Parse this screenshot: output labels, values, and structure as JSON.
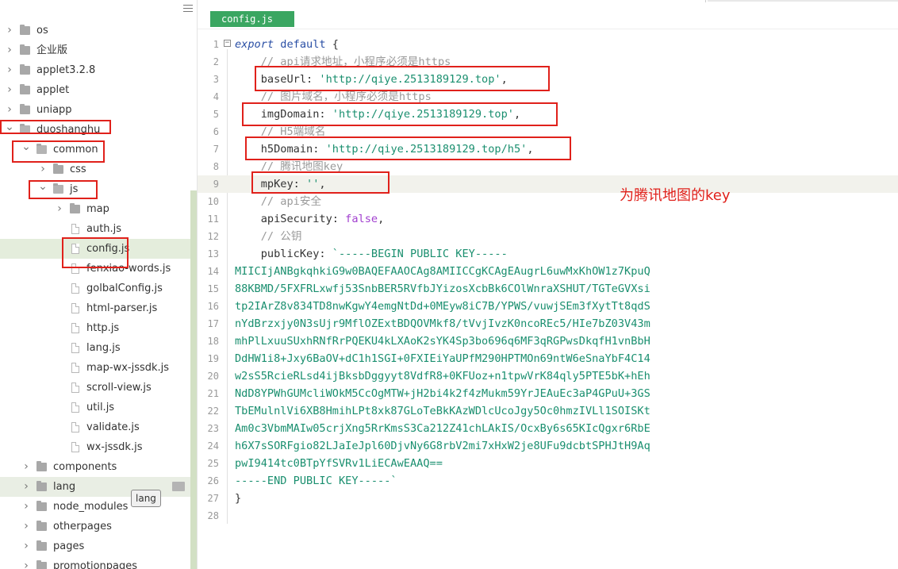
{
  "sidebar": {
    "tooltip": "lang",
    "items": [
      {
        "label": "os",
        "type": "folder",
        "level": 0,
        "state": "collapsed"
      },
      {
        "label": "企业版",
        "type": "folder",
        "level": 0,
        "state": "collapsed"
      },
      {
        "label": "applet3.2.8",
        "type": "folder",
        "level": 0,
        "state": "collapsed"
      },
      {
        "label": "applet",
        "type": "folder",
        "level": 0,
        "state": "collapsed"
      },
      {
        "label": "uniapp",
        "type": "folder",
        "level": 0,
        "state": "collapsed"
      },
      {
        "label": "duoshanghu",
        "type": "folder",
        "level": 0,
        "state": "expanded"
      },
      {
        "label": "common",
        "type": "folder",
        "level": 1,
        "state": "expanded"
      },
      {
        "label": "css",
        "type": "folder",
        "level": 2,
        "state": "collapsed"
      },
      {
        "label": "js",
        "type": "folder",
        "level": 2,
        "state": "expanded"
      },
      {
        "label": "map",
        "type": "folder",
        "level": 3,
        "state": "collapsed"
      },
      {
        "label": "auth.js",
        "type": "file",
        "level": 3
      },
      {
        "label": "config.js",
        "type": "file",
        "level": 3,
        "selected": true
      },
      {
        "label": "fenxiao-words.js",
        "type": "file",
        "level": 3
      },
      {
        "label": "golbalConfig.js",
        "type": "file",
        "level": 3
      },
      {
        "label": "html-parser.js",
        "type": "file",
        "level": 3
      },
      {
        "label": "http.js",
        "type": "file",
        "level": 3
      },
      {
        "label": "lang.js",
        "type": "file",
        "level": 3
      },
      {
        "label": "map-wx-jssdk.js",
        "type": "file",
        "level": 3
      },
      {
        "label": "scroll-view.js",
        "type": "file",
        "level": 3
      },
      {
        "label": "util.js",
        "type": "file",
        "level": 3
      },
      {
        "label": "validate.js",
        "type": "file",
        "level": 3
      },
      {
        "label": "wx-jssdk.js",
        "type": "file",
        "level": 3
      },
      {
        "label": "components",
        "type": "folder",
        "level": 1,
        "state": "collapsed"
      },
      {
        "label": "lang",
        "type": "folder",
        "level": 1,
        "state": "collapsed",
        "hover": true
      },
      {
        "label": "node_modules",
        "type": "folder",
        "level": 1,
        "state": "collapsed"
      },
      {
        "label": "otherpages",
        "type": "folder",
        "level": 1,
        "state": "collapsed"
      },
      {
        "label": "pages",
        "type": "folder",
        "level": 1,
        "state": "collapsed"
      },
      {
        "label": "promotionpages",
        "type": "folder",
        "level": 1,
        "state": "collapsed"
      }
    ]
  },
  "editor": {
    "tab": "config.js",
    "current_line": 9,
    "annotation": "为腾讯地图的key",
    "lines": [
      [
        [
          "kw",
          "export"
        ],
        [
          "t",
          " "
        ],
        [
          "kw2",
          "default"
        ],
        [
          "t",
          " {"
        ]
      ],
      [
        [
          "t",
          "    "
        ],
        [
          "cm",
          "// api请求地址，小程序必须是https"
        ]
      ],
      [
        [
          "t",
          "    "
        ],
        [
          "key",
          "baseUrl"
        ],
        [
          "t",
          ": "
        ],
        [
          "str",
          "'http://qiye.2513189129.top'"
        ],
        [
          "t",
          ","
        ]
      ],
      [
        [
          "t",
          "    "
        ],
        [
          "cm",
          "// 图片域名，小程序必须是https"
        ]
      ],
      [
        [
          "t",
          "    "
        ],
        [
          "key",
          "imgDomain"
        ],
        [
          "t",
          ": "
        ],
        [
          "str",
          "'http://qiye.2513189129.top'"
        ],
        [
          "t",
          ","
        ]
      ],
      [
        [
          "t",
          "    "
        ],
        [
          "cm",
          "// H5端域名"
        ]
      ],
      [
        [
          "t",
          "    "
        ],
        [
          "key",
          "h5Domain"
        ],
        [
          "t",
          ": "
        ],
        [
          "str",
          "'http://qiye.2513189129.top/h5'"
        ],
        [
          "t",
          ","
        ]
      ],
      [
        [
          "t",
          "    "
        ],
        [
          "cm",
          "// 腾讯地图key"
        ]
      ],
      [
        [
          "t",
          "    "
        ],
        [
          "key",
          "mpKey"
        ],
        [
          "t",
          ": "
        ],
        [
          "str",
          "''"
        ],
        [
          "t",
          ","
        ]
      ],
      [
        [
          "t",
          "    "
        ],
        [
          "cm",
          "// api安全"
        ]
      ],
      [
        [
          "t",
          "    "
        ],
        [
          "key",
          "apiSecurity"
        ],
        [
          "t",
          ": "
        ],
        [
          "bool",
          "false"
        ],
        [
          "t",
          ","
        ]
      ],
      [
        [
          "t",
          "    "
        ],
        [
          "cm",
          "// 公钥"
        ]
      ],
      [
        [
          "t",
          "    "
        ],
        [
          "key",
          "publicKey"
        ],
        [
          "t",
          ": "
        ],
        [
          "str",
          "`-----BEGIN PUBLIC KEY-----"
        ]
      ],
      [
        [
          "str",
          "MIICIjANBgkqhkiG9w0BAQEFAAOCAg8AMIICCgKCAgEAugrL6uwMxKhOW1z7KpuQ"
        ]
      ],
      [
        [
          "str",
          "88KBMD/5FXFRLxwfj53SnbBER5RVfbJYizosXcbBk6COlWnraXSHUT/TGTeGVXsi"
        ]
      ],
      [
        [
          "str",
          "tp2IArZ8v834TD8nwKgwY4emgNtDd+0MEyw8iC7B/YPWS/vuwjSEm3fXytTt8qdS"
        ]
      ],
      [
        [
          "str",
          "nYdBrzxjy0N3sUjr9MflOZExtBDQOVMkf8/tVvjIvzK0ncoREc5/HIe7bZ03V43m"
        ]
      ],
      [
        [
          "str",
          "mhPlLxuuSUxhRNfRrPQEKU4kLXAoK2sYK4Sp3bo696q6MF3qRGPwsDkqfH1vnBbH"
        ]
      ],
      [
        [
          "str",
          "DdHW1i8+Jxy6BaOV+dC1h1SGI+0FXIEiYaUPfM290HPTMOn69ntW6eSnaYbF4C14"
        ]
      ],
      [
        [
          "str",
          "w2sS5RcieRLsd4ijBksbDggyyt8VdfR8+0KFUoz+n1tpwVrK84qly5PTE5bK+hEh"
        ]
      ],
      [
        [
          "str",
          "NdD8YPWhGUMcliWOkM5CcOgMTW+jH2bi4k2f4zMukm59YrJEAuEc3aP4GPuU+3GS"
        ]
      ],
      [
        [
          "str",
          "TbEMulnlVi6XB8HmihLPt8xk87GLoTeBkKAzWDlcUcoJgy5Oc0hmzIVLl1SOISKt"
        ]
      ],
      [
        [
          "str",
          "Am0c3VbmMAIw05crjXng5RrKmsS3Ca212Z41chLAkIS/OcxBy6s65KIcQgxr6RbE"
        ]
      ],
      [
        [
          "str",
          "h6X7sSORFgio82LJaIeJpl60DjvNy6G8rbV2mi7xHxW2je8UFu9dcbtSPHJtH9Aq"
        ]
      ],
      [
        [
          "str",
          "pwI9414tc0BTpYfSVRv1LiECAwEAAQ=="
        ]
      ],
      [
        [
          "str",
          "-----END PUBLIC KEY-----`"
        ]
      ],
      [
        [
          "t",
          "}"
        ]
      ],
      [
        [
          "t",
          ""
        ]
      ]
    ]
  },
  "colors": {
    "tab_bg": "#3aa661",
    "highlight_red": "#e0211b",
    "selected_row": "#e4eddc"
  }
}
